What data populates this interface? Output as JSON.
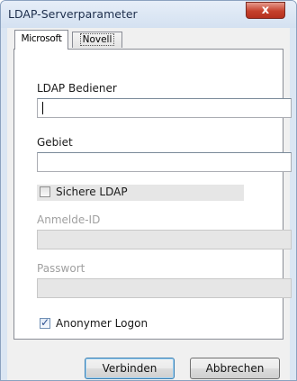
{
  "window": {
    "title": "LDAP-Serverparameter",
    "close_glyph": "x"
  },
  "tabs": [
    {
      "label": "Microsoft",
      "active": true
    },
    {
      "label": "Novell",
      "active": false
    }
  ],
  "form": {
    "operator_label": "LDAP Bediener",
    "operator_value": "",
    "domain_label": "Gebiet",
    "domain_value": "",
    "secure_ldap_label": "Sichere LDAP",
    "secure_ldap_checked": false,
    "login_id_label": "Anmelde-ID",
    "login_id_value": "",
    "password_label": "Passwort",
    "password_value": "",
    "anonymous_label": "Anonymer Logon",
    "anonymous_checked": true
  },
  "buttons": {
    "connect": "Verbinden",
    "cancel": "Abbrechen"
  },
  "colors": {
    "title_bar": "#dbe6f3",
    "close_button": "#c5402c",
    "disabled_field": "#e6e6e6",
    "default_button_border": "#3c7fb1"
  }
}
